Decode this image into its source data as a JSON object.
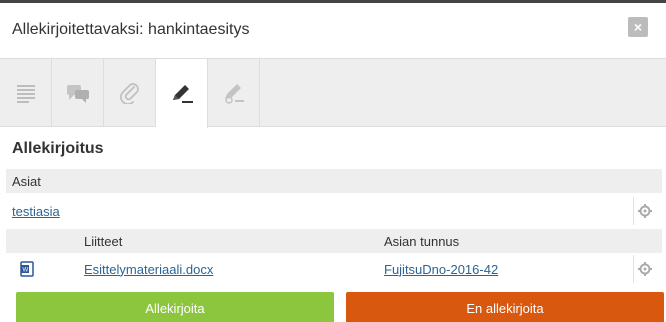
{
  "dialog": {
    "title": "Allekirjoitettavaksi: hankintaesitys",
    "close_label": "×"
  },
  "toolbar": {
    "tabs": [
      {
        "icon": "list-icon",
        "active": false
      },
      {
        "icon": "comments-icon",
        "active": false
      },
      {
        "icon": "attachment-icon",
        "active": false
      },
      {
        "icon": "sign-pen-icon",
        "active": true
      },
      {
        "icon": "sign-disabled-icon",
        "active": false
      }
    ]
  },
  "section": {
    "title": "Allekirjoitus"
  },
  "table": {
    "header_cases": "Asiat",
    "case_link": "testiasia",
    "col_attachments": "Liitteet",
    "col_case_id": "Asian tunnus",
    "file_name": "Esittelymateriaali.docx",
    "case_id": "FujitsuDno-2016-42"
  },
  "actions": {
    "sign_label": "Allekirjoita",
    "nosign_label": "En allekirjoita"
  },
  "colors": {
    "sign": "#8cc63e",
    "nosign": "#d9580f",
    "link": "#2a6496"
  }
}
